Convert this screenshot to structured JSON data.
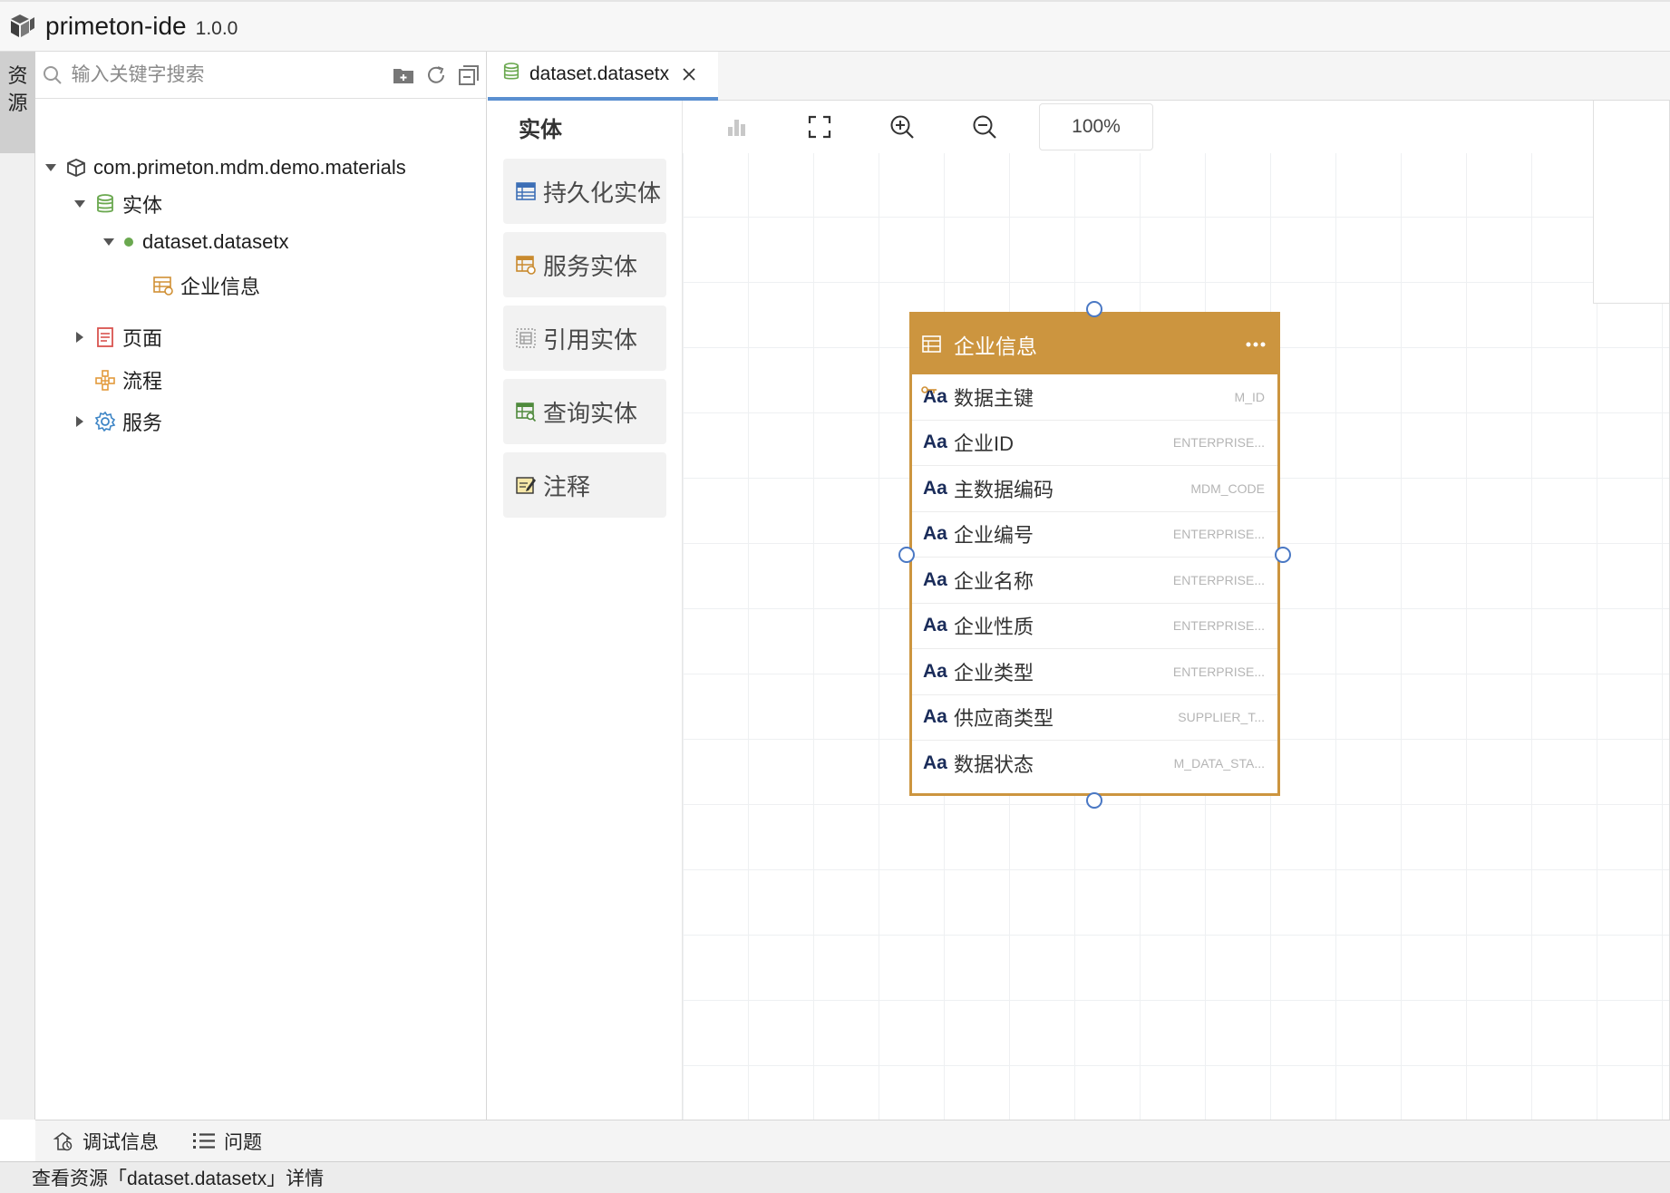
{
  "app": {
    "name": "primeton-ide",
    "version": "1.0.0"
  },
  "side_tab": {
    "char1": "资",
    "char2": "源"
  },
  "resource": {
    "search_placeholder": "输入关键字搜索",
    "tree": {
      "root": "com.primeton.mdm.demo.materials",
      "entity_folder": "实体",
      "dataset": "dataset.datasetx",
      "entity_item": "企业信息",
      "page_folder": "页面",
      "flow_folder": "流程",
      "service_folder": "服务"
    }
  },
  "editor_tab": {
    "label": "dataset.datasetx"
  },
  "palette": {
    "title": "实体",
    "items": [
      {
        "label": "持久化实体",
        "icon": "persistent-entity-icon"
      },
      {
        "label": "服务实体",
        "icon": "service-entity-icon"
      },
      {
        "label": "引用实体",
        "icon": "reference-entity-icon"
      },
      {
        "label": "查询实体",
        "icon": "query-entity-icon"
      },
      {
        "label": "注释",
        "icon": "annotation-icon"
      }
    ]
  },
  "toolbar": {
    "zoom": "100%"
  },
  "entity": {
    "title": "企业信息",
    "type_label": "Aa",
    "fields": [
      {
        "name": "数据主键",
        "code": "M_ID",
        "primary_key": true
      },
      {
        "name": "企业ID",
        "code": "ENTERPRISE..."
      },
      {
        "name": "主数据编码",
        "code": "MDM_CODE"
      },
      {
        "name": "企业编号",
        "code": "ENTERPRISE..."
      },
      {
        "name": "企业名称",
        "code": "ENTERPRISE..."
      },
      {
        "name": "企业性质",
        "code": "ENTERPRISE..."
      },
      {
        "name": "企业类型",
        "code": "ENTERPRISE..."
      },
      {
        "name": "供应商类型",
        "code": "SUPPLIER_T..."
      },
      {
        "name": "数据状态",
        "code": "M_DATA_STA..."
      }
    ]
  },
  "bottom_tabs": {
    "debug": "调试信息",
    "problems": "问题"
  },
  "status": {
    "text": "查看资源「dataset.datasetx」详情"
  },
  "colors": {
    "entity_accent": "#cc953f",
    "tab_accent": "#5a8fd0",
    "port": "#4a78c4"
  }
}
